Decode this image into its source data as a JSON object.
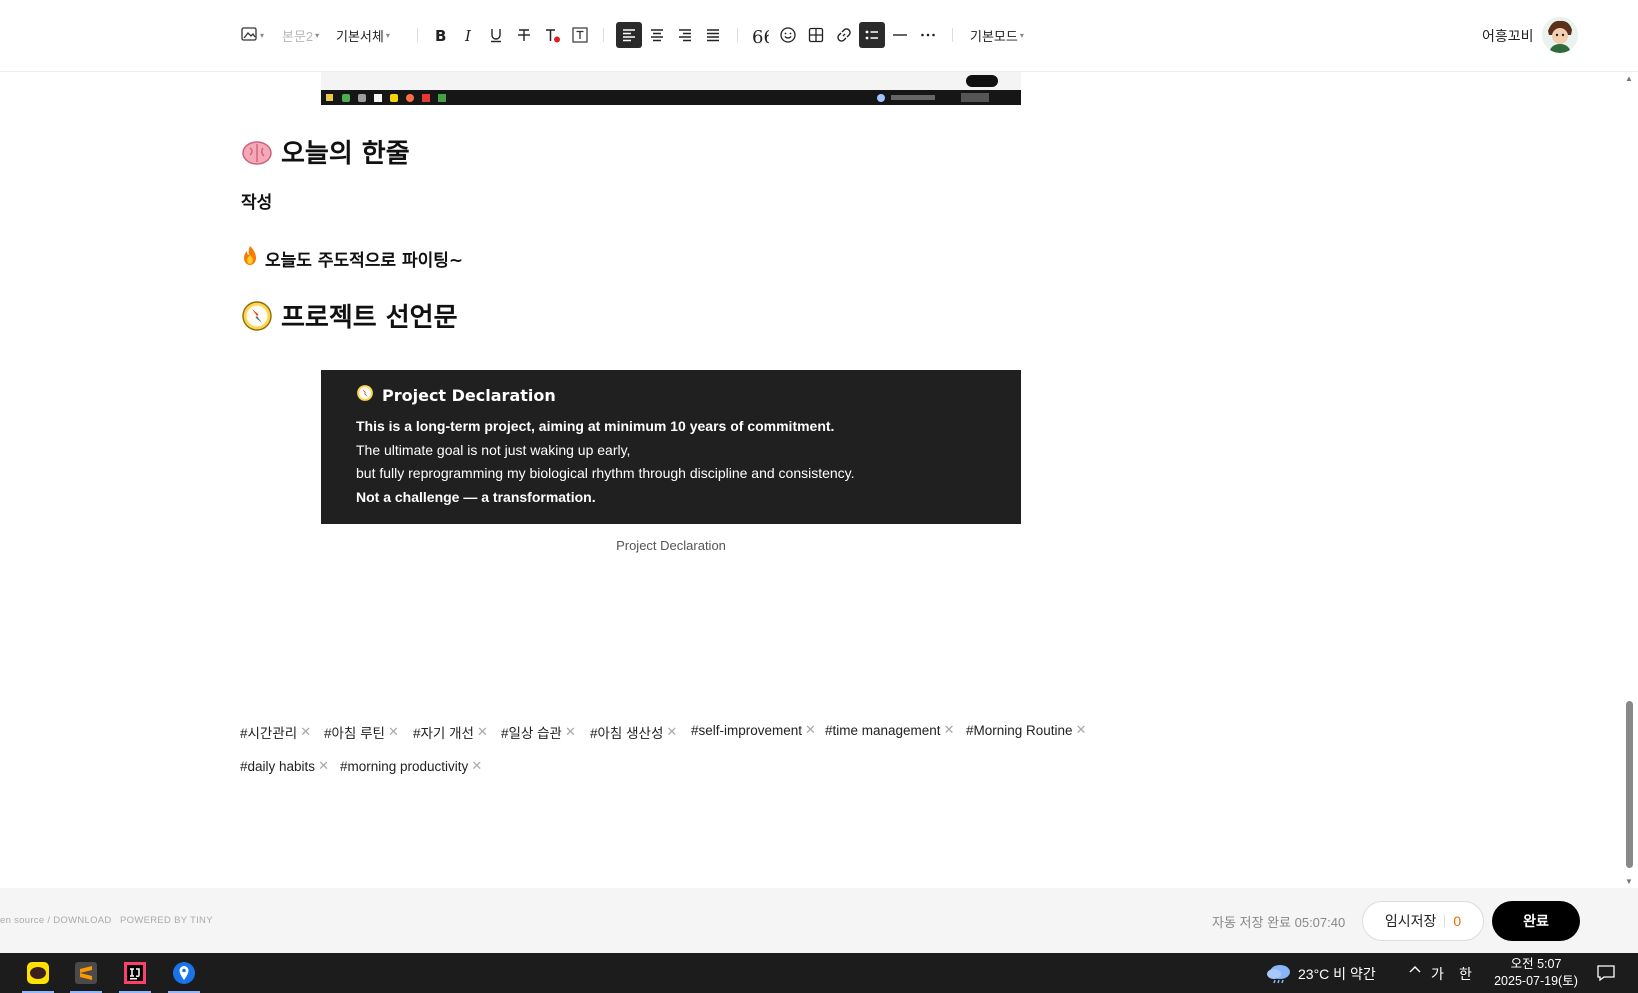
{
  "toolbar": {
    "style_select": "본문2",
    "font_select": "기본서체",
    "mode_select": "기본모드",
    "user_name": "어흥꼬비"
  },
  "content": {
    "heading1": "오늘의 한줄",
    "subheading": "작성",
    "line1": "오늘도 주도적으로 파이팅~",
    "heading2": "프로젝트 선언문",
    "declaration": {
      "title": "Project Declaration",
      "line1": "This is a long-term project, aiming at minimum 10 years of commitment.",
      "line2": "The ultimate goal is not just waking up early,",
      "line3": "but fully reprogramming my biological rhythm through discipline and consistency.",
      "line4": "Not a challenge — a transformation."
    },
    "caption": "Project Declaration"
  },
  "tags": [
    "#시간관리",
    "#아침 루틴",
    "#자기 개선",
    "#일상 습관",
    "#아침 생산성",
    "#self-improvement",
    "#time management",
    "#Morning Routine",
    "#daily habits",
    "#morning productivity"
  ],
  "footer": {
    "link1": "en source / DOWNLOAD",
    "link2": "POWERED BY TINY",
    "autosave_label": "자동 저장 완료",
    "autosave_time": "05:07:40",
    "save_label": "임시저장",
    "save_count": "0",
    "done_label": "완료"
  },
  "taskbar": {
    "weather": "23°C  비 약간",
    "ime_lang": "가",
    "ime_mode": "한",
    "time": "오전 5:07",
    "date": "2025-07-19(토)"
  },
  "colors": {
    "accent_dark": "#2b2b2b",
    "declaration_bg": "#202020",
    "save_count": "#e36e00",
    "done_button": "#000000"
  }
}
